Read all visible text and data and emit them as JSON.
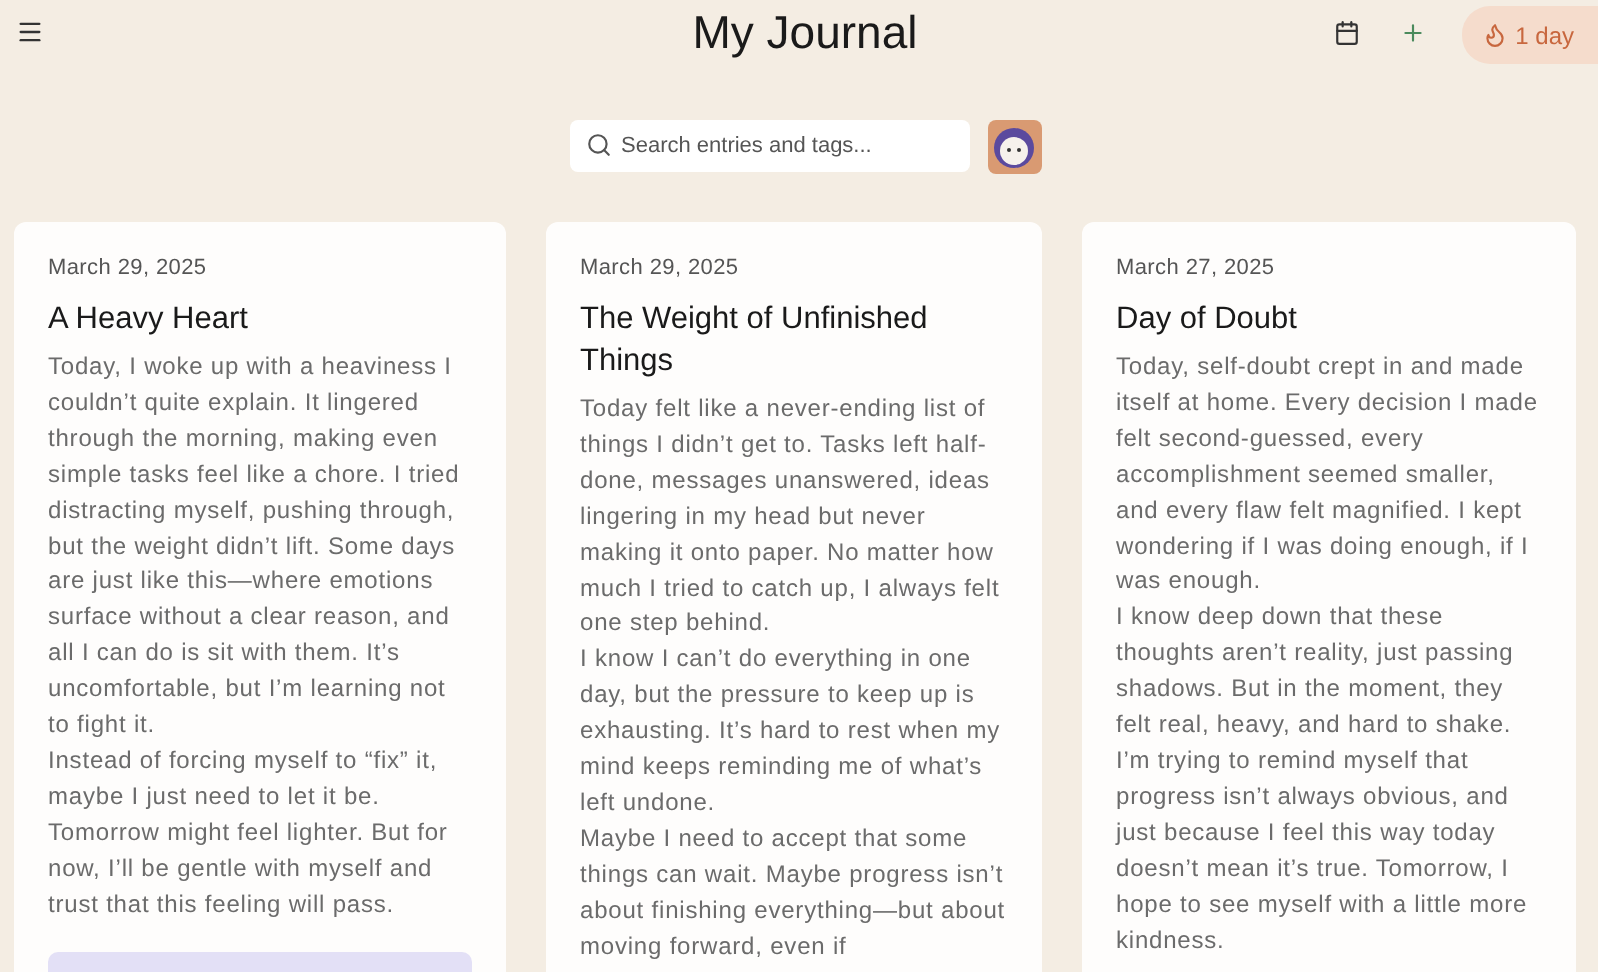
{
  "header": {
    "title": "My Journal",
    "streak": "1 day"
  },
  "search": {
    "placeholder": "Search entries and tags..."
  },
  "entries": [
    {
      "date": "March 29, 2025",
      "title": "A Heavy Heart",
      "paragraphs": [
        "Today, I woke up with a heaviness I couldn’t quite explain. It lingered through the morning, making even simple tasks feel like a chore. I tried distracting myself, pushing through, but the weight didn’t lift. Some days are just like this—where emotions surface without a clear reason, and all I can do is sit with them. It’s uncomfortable, but I’m learning not to fight it.",
        "Instead of forcing myself to “fix” it, maybe I just need to let it be. Tomorrow might feel lighter. But for now, I’ll be gentle with myself and trust that this feeling will pass."
      ],
      "footer_panel": true
    },
    {
      "date": "March 29, 2025",
      "title": "The Weight of Unfinished Things",
      "paragraphs": [
        "Today felt like a never-ending list of things I didn’t get to. Tasks left half-done, messages unanswered, ideas lingering in my head but never making it onto paper. No matter how much I tried to catch up, I always felt one step behind.",
        "I know I can’t do everything in one day, but the pressure to keep up is exhausting. It’s hard to rest when my mind keeps reminding me of what’s left undone.",
        "Maybe I need to accept that some things can wait. Maybe progress isn’t about finishing everything—but about moving forward, even if"
      ],
      "footer_panel": false
    },
    {
      "date": "March 27, 2025",
      "title": "Day of Doubt",
      "paragraphs": [
        "Today, self-doubt crept in and made itself at home. Every decision I made felt second-guessed, every accomplishment seemed smaller, and every flaw felt magnified. I kept wondering if I was doing enough, if I was enough.",
        "I know deep down that these thoughts aren’t reality, just passing shadows. But in the moment, they felt real, heavy, and hard to shake. I’m trying to remind myself that progress isn’t always obvious, and just because I feel this way today doesn’t mean it’s true. Tomorrow, I hope to see myself with a little more kindness."
      ],
      "footer_panel": false
    }
  ]
}
